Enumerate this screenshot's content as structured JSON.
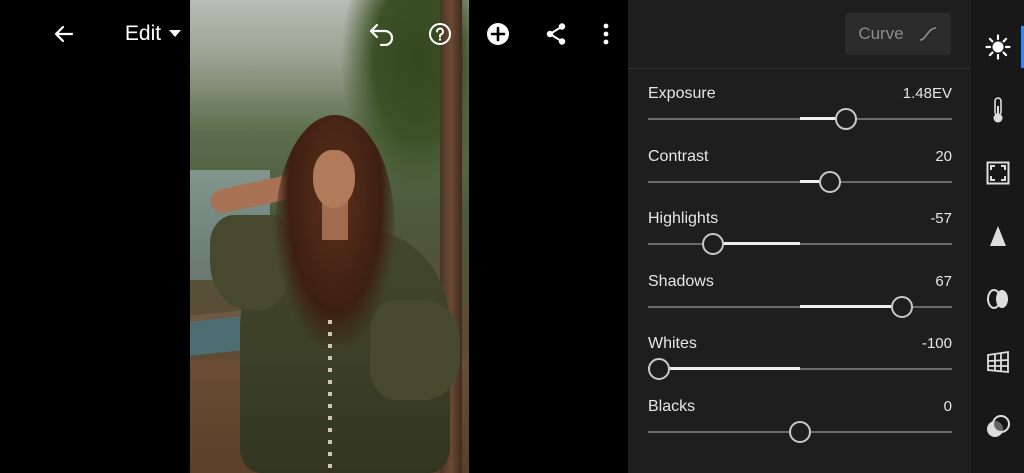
{
  "toolbar": {
    "back_icon": "arrow-left-icon",
    "edit_label": "Edit",
    "edit_dropdown_icon": "caret-down-icon",
    "undo_icon": "undo-icon",
    "help_icon": "help-circle-icon",
    "add_icon": "plus-circle-icon",
    "share_icon": "share-icon",
    "more_icon": "more-vertical-icon"
  },
  "panel": {
    "curve_label": "Curve",
    "curve_icon": "curve-icon",
    "sliders": [
      {
        "label": "Exposure",
        "value": "1.48EV",
        "fraction": 0.65
      },
      {
        "label": "Contrast",
        "value": "20",
        "fraction": 0.6
      },
      {
        "label": "Highlights",
        "value": "-57",
        "fraction": 0.215
      },
      {
        "label": "Shadows",
        "value": "67",
        "fraction": 0.835
      },
      {
        "label": "Whites",
        "value": "-100",
        "fraction": 0.0
      },
      {
        "label": "Blacks",
        "value": "0",
        "fraction": 0.5
      }
    ]
  },
  "rail": {
    "items": [
      {
        "name": "light-icon",
        "active": true
      },
      {
        "name": "color-temperature-icon",
        "active": false
      },
      {
        "name": "effects-frame-icon",
        "active": false
      },
      {
        "name": "detail-triangle-icon",
        "active": false
      },
      {
        "name": "optics-icon",
        "active": false
      },
      {
        "name": "geometry-grid-icon",
        "active": false
      },
      {
        "name": "mask-circles-icon",
        "active": false
      }
    ]
  },
  "colors": {
    "accent": "#2f86ff",
    "panel_bg": "#1e1e1e",
    "rail_bg": "#181818",
    "track": "#6a6a6a",
    "fill": "#f0f0f0"
  }
}
